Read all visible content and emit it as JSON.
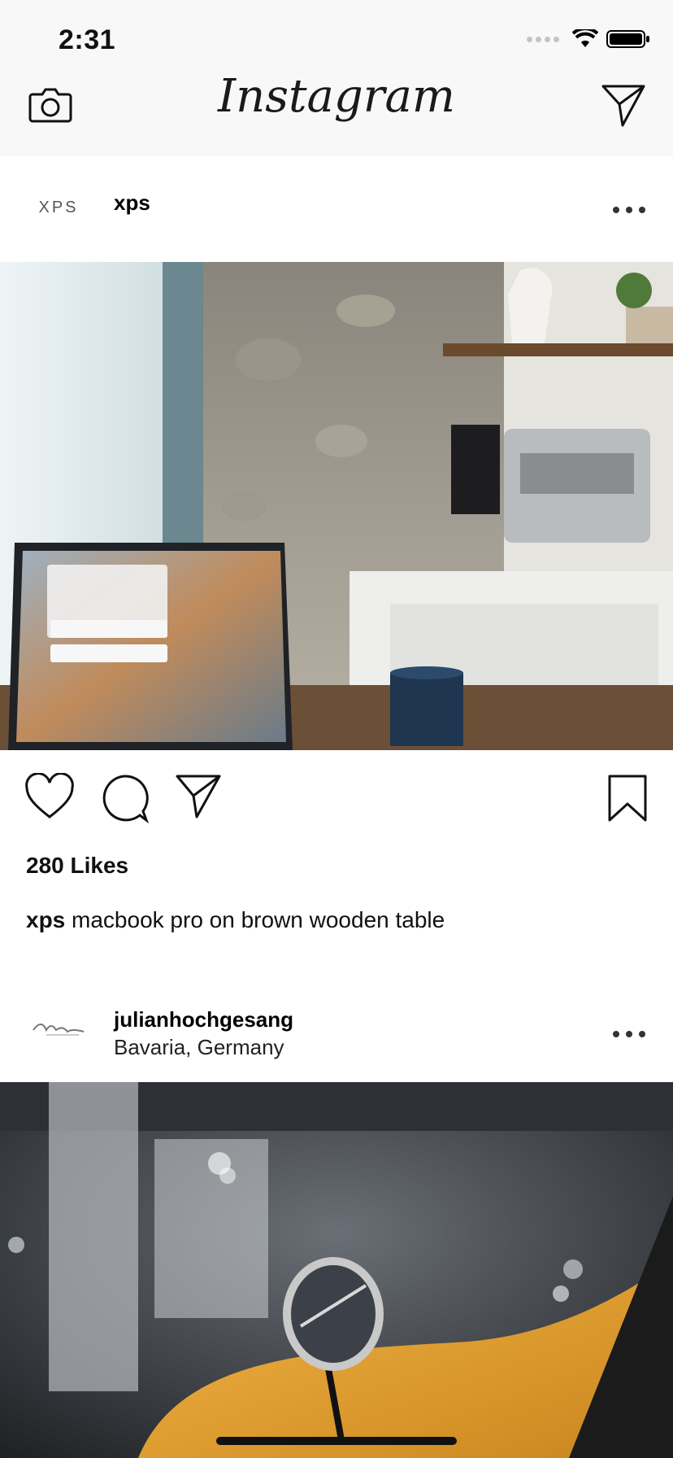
{
  "status_bar": {
    "time": "2:31"
  },
  "nav": {
    "title": "Instagram"
  },
  "posts": [
    {
      "username": "xps",
      "avatar_text": "XPS",
      "likes": "280 Likes",
      "caption_user": "xps",
      "caption_text": "macbook pro on brown wooden table"
    },
    {
      "username": "julianhochgesang",
      "location": "Bavaria, Germany"
    }
  ],
  "colors": {
    "topbar": "#f8f8f8",
    "text": "#111111",
    "mustard": "#e8a63a"
  }
}
